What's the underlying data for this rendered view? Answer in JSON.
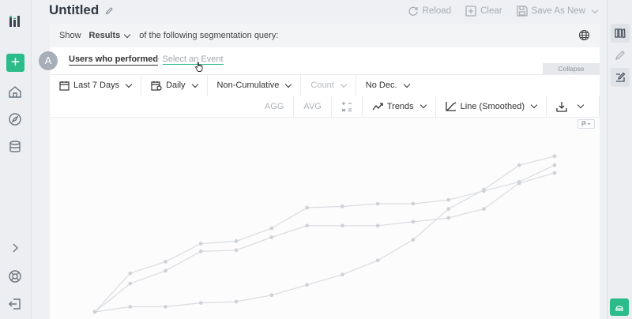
{
  "header": {
    "title": "Untitled"
  },
  "top_actions": {
    "reload": "Reload",
    "clear": "Clear",
    "save_as_new": "Save As New"
  },
  "query": {
    "show_label": "Show",
    "results_label": "Results",
    "segmentation_text": "of the following segmentation query:"
  },
  "event": {
    "badge": "A",
    "users_performed": "Users who performed",
    "select_prefix": "+",
    "select_label": "Select an Event",
    "collapse_label": "Collapse"
  },
  "controls": {
    "date_range": "Last 7 Days",
    "interval": "Daily",
    "cumulative": "Non-Cumulative",
    "count": "Count",
    "decimals": "No Dec.",
    "agg": "AGG",
    "avg": "AVG",
    "trends": "Trends",
    "line_type": "Line (Smoothed)"
  },
  "colors": {
    "accent": "#2bbc8a",
    "line": "#d9dcdf",
    "point": "#cfd3d7"
  },
  "chart_data": {
    "type": "line",
    "x": [
      0,
      1,
      2,
      3,
      4,
      5,
      6,
      7,
      8,
      9,
      10,
      11,
      12,
      13
    ],
    "series": [
      {
        "values": [
          0,
          30,
          39,
          53,
          55,
          65,
          81,
          82,
          84,
          84,
          87,
          94,
          101,
          114
        ]
      },
      {
        "values": [
          0,
          22,
          32,
          47,
          48,
          58,
          67,
          67,
          67,
          70,
          73,
          80,
          100,
          108
        ]
      },
      {
        "values": [
          0,
          4,
          4,
          7,
          8,
          13,
          21,
          29,
          40,
          56,
          80,
          95,
          114,
          121
        ]
      }
    ],
    "ylim": [
      0,
      135
    ],
    "grid": false,
    "legend": "none"
  }
}
